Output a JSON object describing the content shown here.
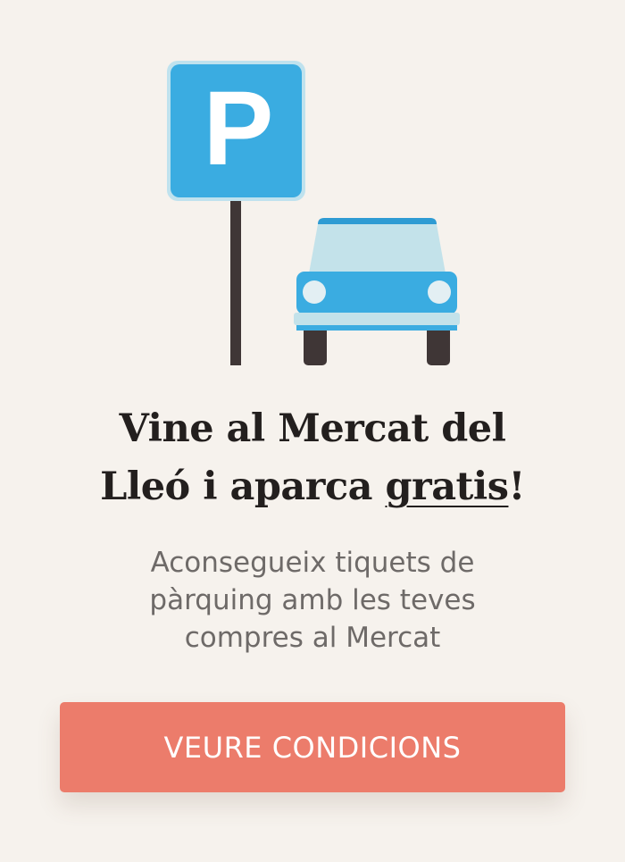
{
  "illustration": {
    "parking_sign_letter": "P",
    "colors": {
      "sign_blue": "#3aace1",
      "sign_border": "#bfe2ee",
      "pole": "#3f3636",
      "car_roof_stripe": "#2e9bd3",
      "car_windshield": "#c3e2ea",
      "car_body": "#3aace1",
      "car_bumper": "#c3e2ea",
      "headlights": "#e3eff3",
      "tires": "#3f3636"
    }
  },
  "headline": {
    "line1": "Vine al Mercat del",
    "line2_pre": "Lleó i aparca ",
    "line2_emph": "gratis",
    "line2_post": "!"
  },
  "subtitle": {
    "line1": "Aconsegueix tiquets de",
    "line2": "pàrquing amb les teves",
    "line3": "compres al Mercat"
  },
  "cta": {
    "label": "VEURE CONDICIONS",
    "color": "#ec7c6b"
  },
  "page": {
    "background": "#f6f2ed"
  }
}
